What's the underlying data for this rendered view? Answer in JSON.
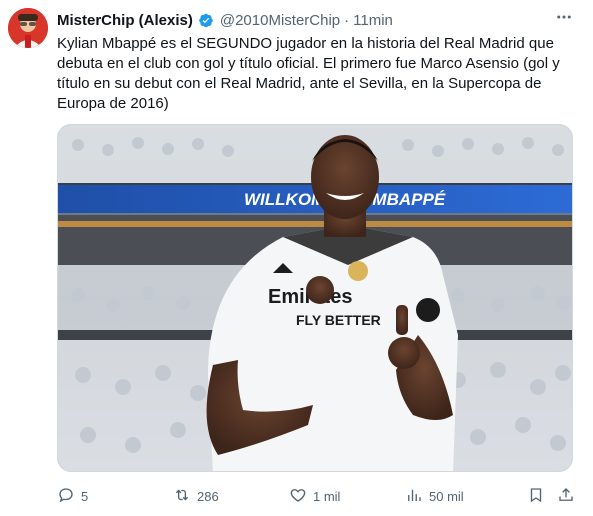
{
  "author": {
    "name": "MisterChip (Alexis)",
    "handle": "@2010MisterChip",
    "separator": "·",
    "time": "11min"
  },
  "tweet": {
    "text": "Kylian Mbappé es el SEGUNDO jugador en la historia del Real Madrid que\ndebuta en el club con gol y título oficial. El primero fue Marco Asensio (gol y\ntítulo en su debut con el Real Madrid, ante el Sevilla, en la Supercopa de\nEuropa de 2016)"
  },
  "media": {
    "banner_text": "WILLKOMMEN, MBAPPÉ",
    "shirt_text": "Emirates FLY BETTER"
  },
  "actions": {
    "replies": "5",
    "reposts": "286",
    "likes": "1 mil",
    "views": "50 mil"
  },
  "icons": {
    "more": "more-icon",
    "verified": "verified-badge-icon",
    "reply": "reply-icon",
    "repost": "repost-icon",
    "like": "heart-icon",
    "views": "views-icon",
    "bookmark": "bookmark-icon",
    "share": "share-icon"
  },
  "colors": {
    "verified": "#1d9bf0",
    "secondary_text": "#536471"
  }
}
